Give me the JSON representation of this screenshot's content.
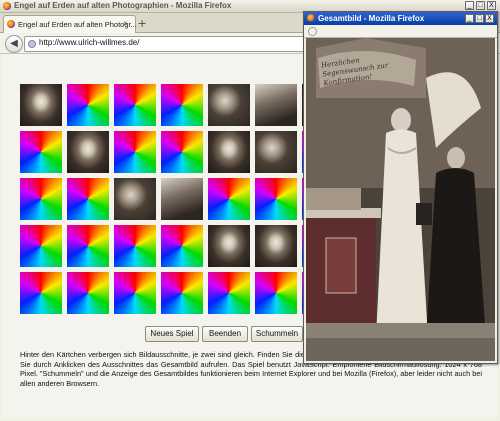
{
  "main_window": {
    "title": "Engel auf Erden auf alten Photographien - Mozilla Firefox",
    "tab_label": "Engel auf Erden auf alten Photogr...",
    "new_tab_symbol": "+",
    "close_symbol": "×",
    "url": "http://www.ulrich-willmes.de/",
    "controls": {
      "minimize": "_",
      "maximize": "□",
      "close": "X"
    }
  },
  "game": {
    "grid": [
      [
        "photo",
        "swirl",
        "swirl",
        "swirl",
        "photo2",
        "photo3",
        "photo"
      ],
      [
        "swirl",
        "photo",
        "swirl",
        "swirl",
        "photo",
        "photo2",
        "swirl"
      ],
      [
        "swirl",
        "swirl",
        "photo2",
        "photo3",
        "swirl",
        "swirl",
        "swirl"
      ],
      [
        "swirl",
        "swirl",
        "swirl",
        "swirl",
        "photo",
        "photo",
        "swirl"
      ],
      [
        "swirl",
        "swirl",
        "swirl",
        "swirl",
        "swirl",
        "swirl",
        "swirl"
      ]
    ],
    "buttons": {
      "new_game": "Neues Spiel",
      "end": "Beenden",
      "shuffle": "Schummeln"
    },
    "description": "Hinter den Kärtchen verbergen sich Bildausschnitte, je zwei sind gleich. Finden Sie die Paare heraus. Haben Sie ein Paar gefunden, können Sie durch Anklicken des Ausschnittes das Gesamtbild aufrufen. Das Spiel benutzt JavaScript. Empfohlene Bildschirmauflösung: 1024 x 768 Pixel. \"Schummeln\" und die Anzeige des Gesamtbildes funktionieren beim Internet Explorer und bei Mozilla (Firefox), aber leider nicht auch bei allen anderen Browsern."
  },
  "popup_window": {
    "title": "Gesamtbild - Mozilla Firefox",
    "controls": {
      "minimize": "_",
      "maximize": "□",
      "close": "X"
    },
    "card_text": "Herzlichen Segenswunsch zur Konfirmation!"
  }
}
